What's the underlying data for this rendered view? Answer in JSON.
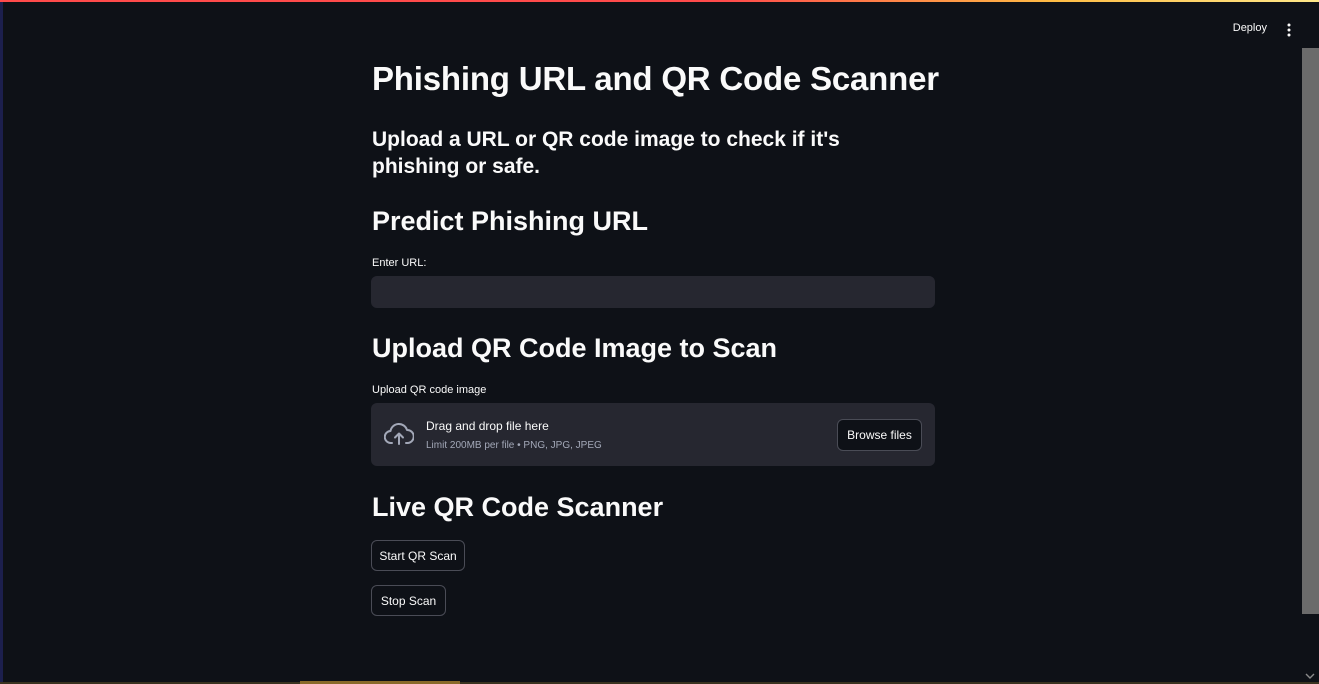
{
  "header": {
    "deploy_label": "Deploy",
    "menu_icon": "kebab-menu-icon"
  },
  "main": {
    "title": "Phishing URL and QR Code Scanner",
    "subtitle": "Upload a URL or QR code image to check if it's phishing or safe.",
    "predict_section": {
      "heading": "Predict Phishing URL",
      "url_label": "Enter URL:",
      "url_value": "",
      "url_placeholder": ""
    },
    "upload_section": {
      "heading": "Upload QR Code Image to Scan",
      "upload_label": "Upload QR code image",
      "drop_title": "Drag and drop file here",
      "drop_subtitle": "Limit 200MB per file • PNG, JPG, JPEG",
      "browse_label": "Browse files",
      "icon": "cloud-upload-icon"
    },
    "live_section": {
      "heading": "Live QR Code Scanner",
      "start_label": "Start QR Scan",
      "stop_label": "Stop Scan"
    }
  },
  "colors": {
    "background": "#0e1117",
    "input_background": "#262730",
    "text": "#fafafa",
    "muted_text": "#a3a8b8",
    "accent_red": "#ff4b4b",
    "accent_yellow": "#ffbd45"
  }
}
